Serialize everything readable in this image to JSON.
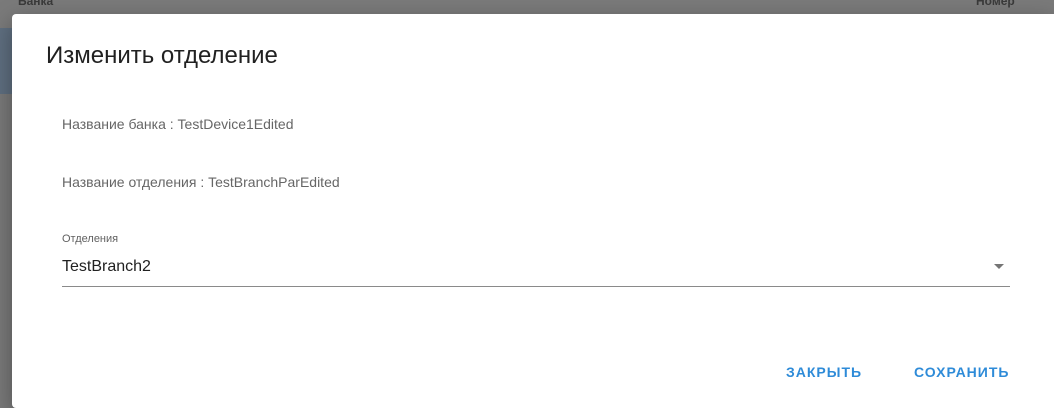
{
  "background": {
    "left_header": "Банка",
    "right_header": "Номер"
  },
  "dialog": {
    "title": "Изменить отделение",
    "bank_name_line": "Название банка : TestDevice1Edited",
    "branch_name_line": "Название отделения : TestBranchParEdited",
    "branches_select": {
      "label": "Отделения",
      "value": "TestBranch2"
    },
    "actions": {
      "close_label": "ЗАКРЫТЬ",
      "save_label": "СОХРАНИТЬ"
    }
  },
  "colors": {
    "accent": "#2e8bd8",
    "backdrop": "#7a7a7a"
  }
}
